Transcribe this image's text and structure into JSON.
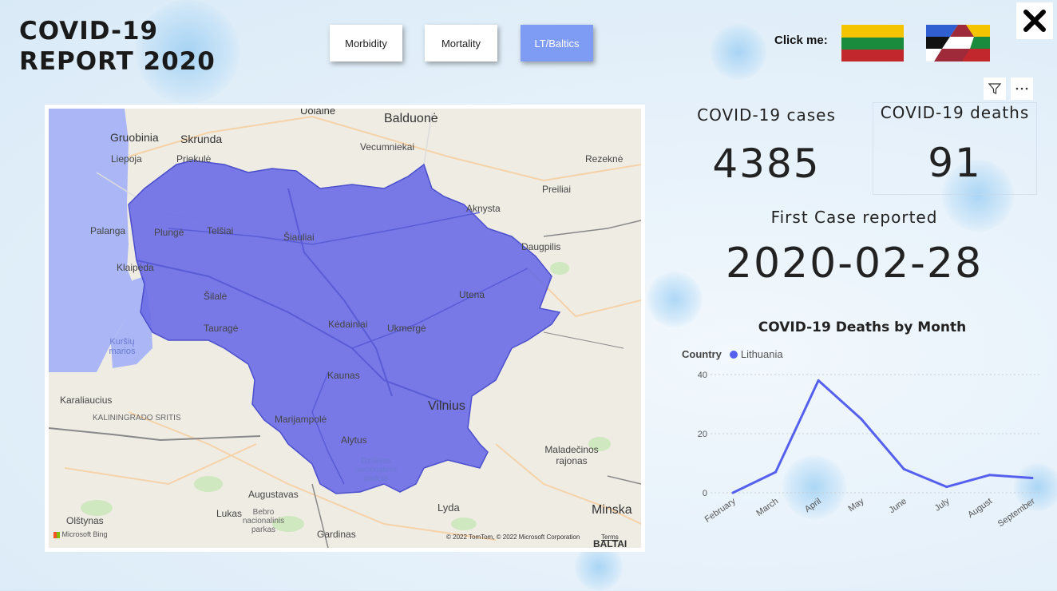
{
  "title": {
    "line1": "COVID-19",
    "line2": "REPORT 2020"
  },
  "nav": {
    "buttons": [
      {
        "label": "Morbidity"
      },
      {
        "label": "Mortality"
      },
      {
        "label": "LT/Baltics",
        "active": true
      }
    ]
  },
  "click_me": "Click me:",
  "flags": [
    {
      "name": "lithuania-flag"
    },
    {
      "name": "baltics-flag"
    }
  ],
  "colors": {
    "accent": "#7f9cf5",
    "region_fill": "#6a6de6",
    "line": "#5560ee"
  },
  "map": {
    "labels": {
      "ulaine": "Uolainė",
      "balduone": "Balduonė",
      "gruobinia": "Gruobinia",
      "skrunda": "Skrunda",
      "liepoja": "Liepoja",
      "priekule": "Priekulė",
      "vecumniekai": "Vecumniekai",
      "rezekne": "Rezeknė",
      "preiliai": "Preiliai",
      "aknysta": "Aknysta",
      "palanga": "Palanga",
      "plunge": "Plungė",
      "telsiai": "Telšiai",
      "siauliai": "Šiauliai",
      "daugpilis": "Daugpilis",
      "klaipeda": "Klaipėda",
      "utena": "Utena",
      "silale": "Šilalė",
      "taurage": "Tauragė",
      "kedainiai": "Kėdainiai",
      "ukmerge": "Ukmergė",
      "kursiu_marios": "Kuršių marios",
      "kaunas": "Kaunas",
      "karaliaucius": "Karaliaucius",
      "kaliningrado": "KALININGRADO SRITIS",
      "vilnius": "Vilnius",
      "marijampole": "Marijampolė",
      "alytus": "Alytus",
      "dzukijos": "Dzūkijos nacionalinis parkas",
      "maladecinos": "Maladečinos rajonas",
      "augustavas": "Augustavas",
      "olstynas": "Olštynas",
      "lukas": "Lukas",
      "bebro": "Bebro nacionalinis parkas",
      "lyda": "Lyda",
      "minska": "Minska",
      "gardinas": "Gardinas",
      "baltai": "BALTAI"
    },
    "bing": "Microsoft Bing",
    "copyright": "© 2022 TomTom, © 2022 Microsoft Corporation",
    "terms": "Terms"
  },
  "cards": {
    "cases_label": "COVID-19 cases",
    "cases_value": "4385",
    "deaths_label": "COVID-19 deaths",
    "deaths_value": "91",
    "first_case_label": "First Case reported",
    "first_case_value": "2020-02-28"
  },
  "visual_icons": [
    "filter-icon",
    "more-options-icon"
  ],
  "legend": {
    "title": "Country",
    "series": "Lithuania"
  },
  "chart_data": {
    "type": "line",
    "title": "COVID-19 Deaths by Month",
    "categories": [
      "February",
      "March",
      "April",
      "May",
      "June",
      "July",
      "August",
      "September"
    ],
    "series": [
      {
        "name": "Lithuania",
        "values": [
          0,
          7,
          38,
          25,
          8,
          2,
          6,
          5
        ]
      }
    ],
    "yticks": [
      0,
      20,
      40
    ],
    "ylim": [
      0,
      40
    ],
    "grid": true,
    "legend_position": "top-left"
  }
}
